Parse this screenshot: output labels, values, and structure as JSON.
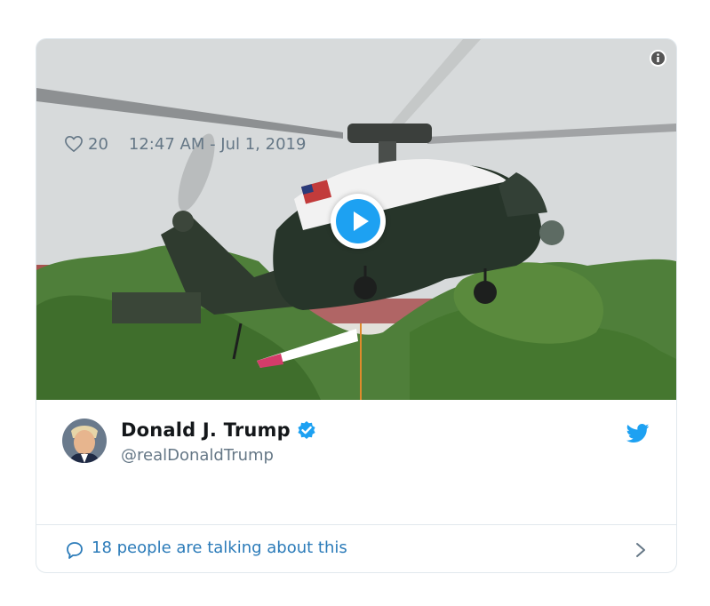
{
  "tweet": {
    "display_name": "Donald J. Trump",
    "handle": "@realDonaldTrump",
    "verified": true,
    "like_count": "20",
    "timestamp": "12:47 AM - Jul 1, 2019",
    "talking": "18 people are talking about this"
  },
  "icons": {
    "info": "info-icon",
    "play": "play-icon",
    "verified": "verified-badge-icon",
    "twitter": "twitter-bird-icon",
    "heart": "heart-icon",
    "comment": "comment-icon",
    "chevron": "chevron-right-icon"
  },
  "colors": {
    "accent": "#1da1f2",
    "link": "#2b7bb9",
    "secondary_text": "#657786",
    "border": "#e1e8ed"
  }
}
